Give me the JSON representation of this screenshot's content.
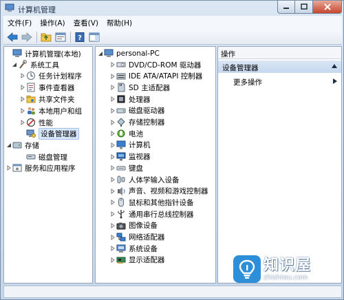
{
  "window": {
    "title": "计算机管理"
  },
  "menubar": {
    "items": [
      "文件(F)",
      "操作(A)",
      "查看(V)",
      "帮助(H)"
    ]
  },
  "toolbar": {
    "buttons": [
      "back-icon",
      "forward-icon",
      "up-folder-icon",
      "properties-icon",
      "help-icon",
      "show-hide-icon"
    ]
  },
  "left_tree": [
    {
      "label": "计算机管理(本地)",
      "icon": "computer-management-icon",
      "arrow": ""
    },
    {
      "label": "系统工具",
      "icon": "tools-icon",
      "arrow": "expanded"
    },
    {
      "label": "任务计划程序",
      "icon": "clock-icon",
      "arrow": "collapsed"
    },
    {
      "label": "事件查看器",
      "icon": "event-viewer-icon",
      "arrow": "collapsed"
    },
    {
      "label": "共享文件夹",
      "icon": "shared-folder-icon",
      "arrow": "collapsed"
    },
    {
      "label": "本地用户和组",
      "icon": "users-icon",
      "arrow": "collapsed"
    },
    {
      "label": "性能",
      "icon": "performance-icon",
      "arrow": "collapsed"
    },
    {
      "label": "设备管理器",
      "icon": "device-manager-icon",
      "arrow": "",
      "selected": true
    },
    {
      "label": "存储",
      "icon": "storage-icon",
      "arrow": "expanded"
    },
    {
      "label": "磁盘管理",
      "icon": "disk-icon",
      "arrow": ""
    },
    {
      "label": "服务和应用程序",
      "icon": "services-icon",
      "arrow": "collapsed"
    }
  ],
  "device_tree": {
    "root": "personal-PC",
    "items": [
      {
        "label": "DVD/CD-ROM 驱动器",
        "icon": "dvd-icon"
      },
      {
        "label": "IDE ATA/ATAPI 控制器",
        "icon": "ide-icon"
      },
      {
        "label": "SD 主适配器",
        "icon": "sd-icon"
      },
      {
        "label": "处理器",
        "icon": "cpu-icon"
      },
      {
        "label": "磁盘驱动器",
        "icon": "disk-drive-icon"
      },
      {
        "label": "存储控制器",
        "icon": "storage-controller-icon"
      },
      {
        "label": "电池",
        "icon": "battery-icon"
      },
      {
        "label": "计算机",
        "icon": "computer-icon"
      },
      {
        "label": "监视器",
        "icon": "monitor-icon"
      },
      {
        "label": "键盘",
        "icon": "keyboard-icon"
      },
      {
        "label": "人体学输入设备",
        "icon": "hid-icon"
      },
      {
        "label": "声音、视频和游戏控制器",
        "icon": "sound-icon"
      },
      {
        "label": "鼠标和其他指针设备",
        "icon": "mouse-icon"
      },
      {
        "label": "通用串行总线控制器",
        "icon": "usb-icon"
      },
      {
        "label": "图像设备",
        "icon": "camera-icon"
      },
      {
        "label": "网络适配器",
        "icon": "network-icon"
      },
      {
        "label": "系统设备",
        "icon": "system-device-icon"
      },
      {
        "label": "显示适配器",
        "icon": "display-adapter-icon"
      }
    ]
  },
  "actions": {
    "header": "操作",
    "section": "设备管理器",
    "more": "更多操作"
  },
  "watermark": {
    "title": "知识屋",
    "url": "zhishiwu.com"
  }
}
